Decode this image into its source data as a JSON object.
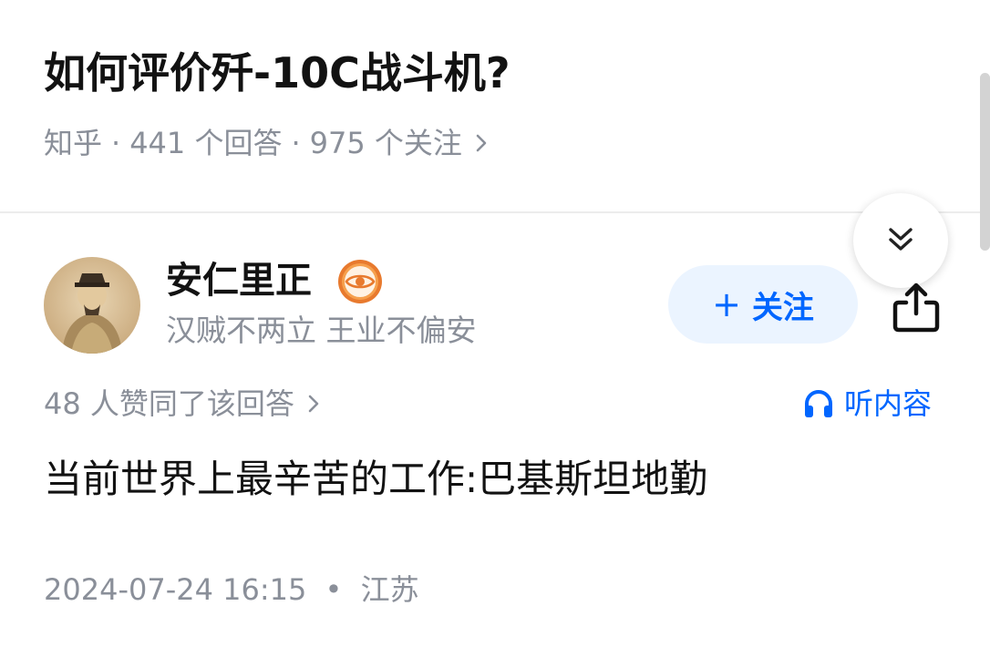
{
  "question": {
    "title": "如何评价歼-10C战斗机?",
    "source": "知乎",
    "separator": "·",
    "answer_count": "441 个回答",
    "follower_count": "975 个关注",
    "chevron_icon": "chevron-right-icon"
  },
  "floating": {
    "collapse_icon": "double-chevron-down-icon"
  },
  "author": {
    "name": "安仁里正",
    "bio": "汉贼不两立 王业不偏安",
    "badge_icon": "eye-badge-icon",
    "follow_plus": "+",
    "follow_label": "关注",
    "share_icon": "share-icon"
  },
  "answer": {
    "votes": "48 人赞同了该回答",
    "listen_label": "听内容",
    "listen_icon": "headphones-icon",
    "content": "当前世界上最辛苦的工作:巴基斯坦地勤",
    "timestamp": "2024-07-24 16:15",
    "separator": "•",
    "location": "江苏"
  },
  "colors": {
    "accent": "#0066ff",
    "follow_bg": "#ebf4ff",
    "meta_text": "#8a8f99",
    "badge": "#e87a2e"
  }
}
